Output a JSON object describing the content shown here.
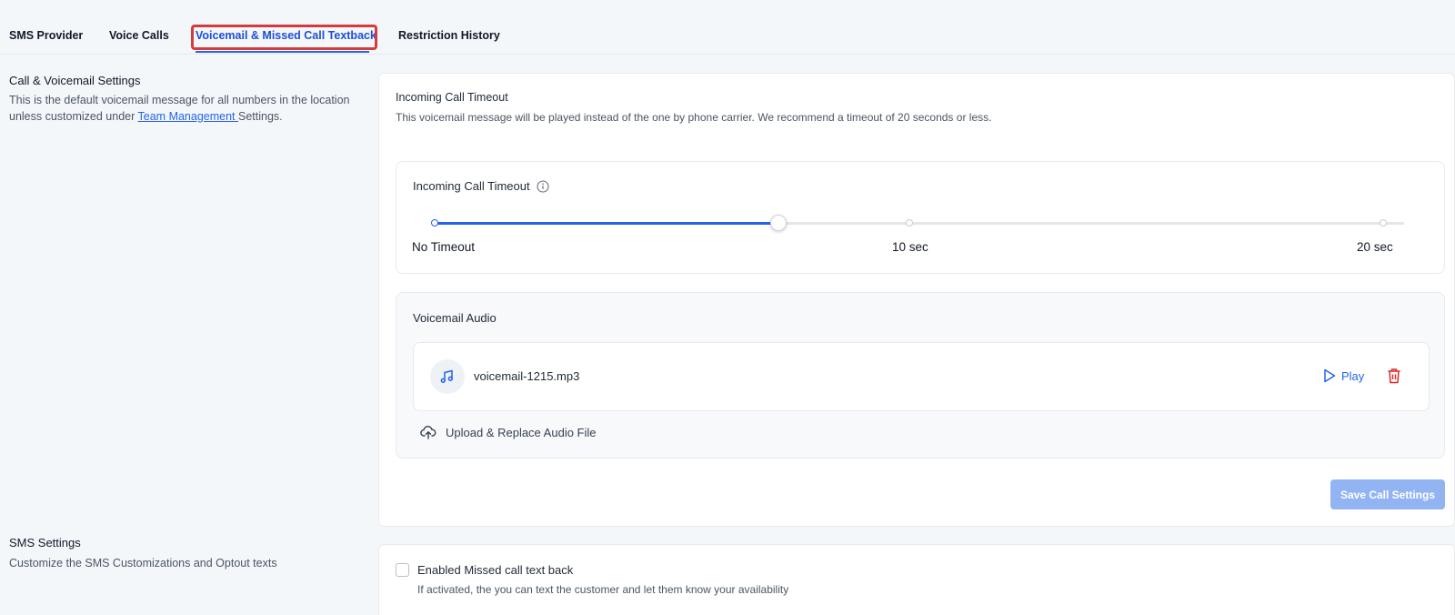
{
  "tabs": {
    "sms_provider": "SMS Provider",
    "voice_calls": "Voice Calls",
    "voicemail": "Voicemail & Missed Call Textback",
    "restriction_history": "Restriction History",
    "active_tab": "Voicemail & Missed Call Textback"
  },
  "call_section": {
    "title": "Call & Voicemail Settings",
    "desc_part1": "This is the default voicemail message for all numbers in the location unless customized under ",
    "desc_link": "Team Management ",
    "desc_part2": "Settings."
  },
  "main_card": {
    "title": "Incoming Call Timeout",
    "desc": "This voicemail message will be played instead of the one by phone carrier. We recommend a timeout of 20 seconds or less."
  },
  "slider": {
    "label": "Incoming Call Timeout",
    "info_icon": "info-icon",
    "ticks": [
      "No Timeout",
      "10 sec",
      "20 sec"
    ],
    "value_fraction": 0.355
  },
  "audio": {
    "title": "Voicemail Audio",
    "file_icon": "music-note-icon",
    "file_name": "voicemail-1215.mp3",
    "play_label": "Play",
    "delete_icon": "trash-icon",
    "upload_label": "Upload & Replace Audio File",
    "upload_icon": "cloud-upload-icon"
  },
  "save_button": "Save Call Settings",
  "sms_section": {
    "title": "SMS Settings",
    "desc": "Customize the SMS Customizations and Optout texts",
    "checkbox_label": "Enabled Missed call text back",
    "checkbox_checked": false,
    "checkbox_desc": "If activated, the you can text the customer and let them know your availability"
  },
  "colors": {
    "accent": "#2563eb",
    "highlight_box": "#d63b3b",
    "save_disabled": "#93b4f3",
    "delete": "#dc2626"
  }
}
